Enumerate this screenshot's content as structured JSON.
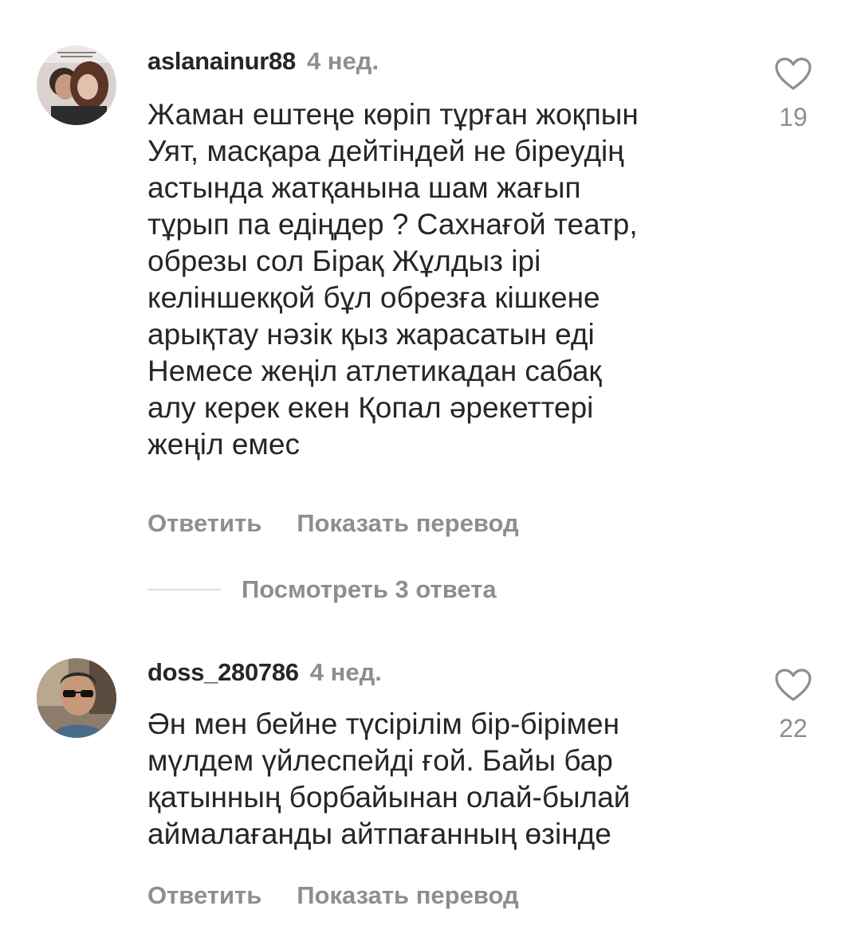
{
  "comments": [
    {
      "username": "aslanainur88",
      "time": "4 нед.",
      "lines": [
        "Жаман ештеңе көріп тұрған жоқпын",
        "Уят, масқара дейтіндей не біреудің",
        "астында жатқанына шам жағып",
        "тұрып па едіңдер ? Сахнағой театр,",
        "обрезы сол Бірақ Жұлдыз ірі",
        "келіншекқой бұл обрезға кішкене",
        "арықтау нәзік қыз жарасатын еді",
        "Немесе жеңіл атлетикадан сабақ",
        "алу керек екен Қопал әрекеттері",
        "жеңіл емес"
      ],
      "likes": "19",
      "reply_label": "Ответить",
      "translate_label": "Показать перевод",
      "view_replies_label": "Посмотреть 3 ответа"
    },
    {
      "username": "doss_280786",
      "time": "4 нед.",
      "lines": [
        "Ән мен бейне түсірілім бір-бірімен",
        "мүлдем үйлеспейді ғой. Байы бар",
        "қатынның борбайынан олай-былай",
        "аймалағанды айтпағанның өзінде"
      ],
      "likes": "22",
      "reply_label": "Ответить",
      "translate_label": "Показать перевод"
    }
  ],
  "icons": {
    "like": "heart-outline-icon"
  },
  "colors": {
    "primary_text": "#262626",
    "secondary_text": "#8e8e8e",
    "divider": "#dbdbdb"
  }
}
